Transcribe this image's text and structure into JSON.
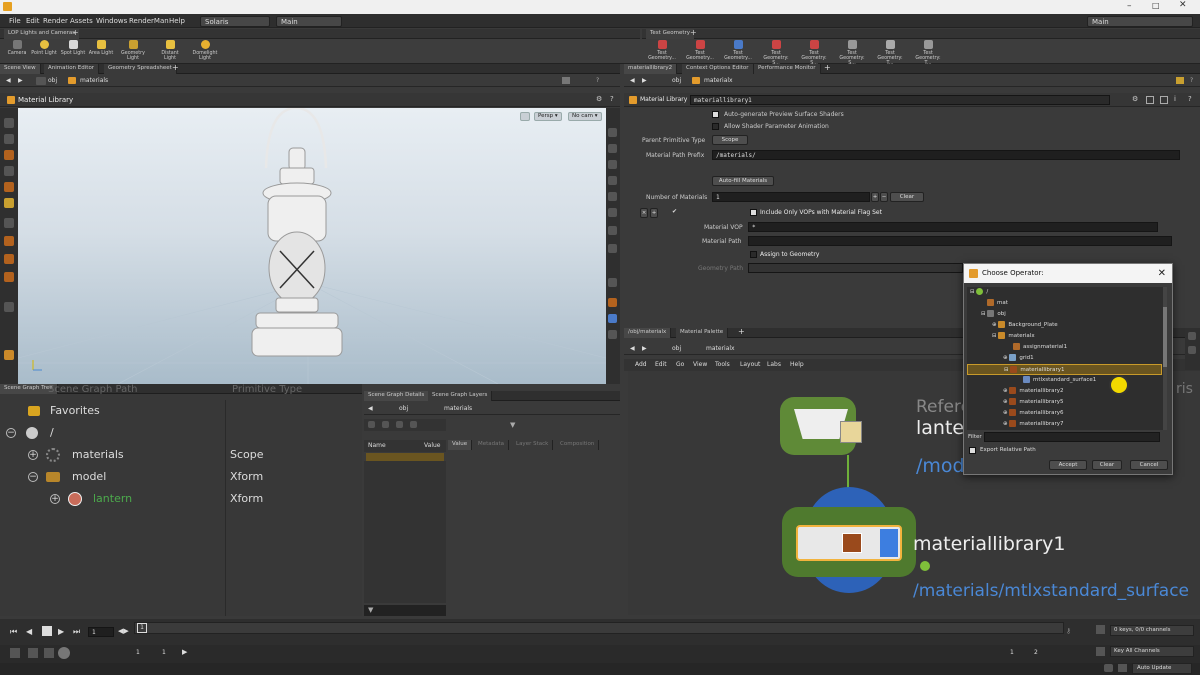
{
  "menubar": {
    "items": [
      "File",
      "Edit",
      "Render",
      "Assets",
      "Windows",
      "RenderMan",
      "Help"
    ],
    "desktop": "Solaris",
    "session": "Main",
    "right_session": "Main"
  },
  "shelf": {
    "left_tab": "LOP Lights and Cameras",
    "right_tab": "Test Geometry",
    "left_tools": [
      "Camera",
      "Point Light",
      "Spot Light",
      "Area Light",
      "Geometry Light",
      "Distant Light",
      "Domelight Light"
    ],
    "right_tools": [
      "Test Geometry...",
      "Test Geometry...",
      "Test Geometry...",
      "Test Geometry: S...",
      "Test Geometry: S...",
      "Test Geometry: S...",
      "Test Geometry: T...",
      "Test Geometry: T..."
    ]
  },
  "left_top": {
    "tabs": [
      "Scene View",
      "Animation Editor",
      "Geometry Spreadsheet"
    ],
    "path": "obj",
    "path2": "materials",
    "title": "Material Library",
    "cam_persp": "Persp",
    "cam_nocam": "No cam"
  },
  "scene_tree": {
    "tab": "Scene Graph Tree",
    "col_path": "Scene Graph Path",
    "col_type": "Primitive Type",
    "rows": [
      {
        "label": "Favorites",
        "type": ""
      },
      {
        "label": "/",
        "type": ""
      },
      {
        "label": "materials",
        "type": "Scope"
      },
      {
        "label": "model",
        "type": "Xform"
      },
      {
        "label": "lantern",
        "type": "Xform"
      }
    ]
  },
  "details": {
    "tabs": [
      "Scene Graph Details",
      "Scene Graph Layers"
    ],
    "path": "obj",
    "path2": "materials",
    "col_name": "Name",
    "col_value": "Value",
    "subtabs": [
      "Value",
      "Metadata",
      "Layer Stack",
      "Composition"
    ]
  },
  "params": {
    "tabs": [
      "materiallibrary2",
      "Context Options Editor",
      "Performance Monitor"
    ],
    "path": "obj",
    "path2": "materialx",
    "node_type": "Material Library",
    "node_name": "materiallibrary1",
    "auto_preview": "Auto-generate Preview Surface Shaders",
    "allow_anim": "Allow Shader Parameter Animation",
    "parent_prim_label": "Parent Primitive Type",
    "parent_prim_value": "Scope",
    "prefix_label": "Material Path Prefix",
    "prefix_value": "/materials/",
    "autofill": "Auto-fill Materials",
    "num_label": "Number of Materials",
    "num_value": "1",
    "clear": "Clear",
    "include_only": "Include Only VOPs with Material Flag Set",
    "vop_label": "Material VOP",
    "vop_value": "*",
    "matpath_label": "Material Path",
    "assign_label": "Assign to Geometry",
    "geopath_label": "Geometry Path"
  },
  "network": {
    "tabs": [
      "/obj/materialx",
      "Material Palette"
    ],
    "path": "obj",
    "path2": "materialx",
    "menu": [
      "Add",
      "Edit",
      "Go",
      "View",
      "Tools",
      "Layout",
      "Labs",
      "Help"
    ],
    "ref_label": "Refere",
    "ref_node": "lante",
    "ref_path": "/mod",
    "node_name": "materiallibrary1",
    "node_path": "/materials/mtlxstandard_surface",
    "edge_text": "ris"
  },
  "dialog": {
    "title": "Choose Operator:",
    "filter_label": "Filter",
    "export_label": "Export Relative Path",
    "accept": "Accept",
    "clear": "Clear",
    "cancel": "Cancel",
    "tree": [
      "/",
      "mat",
      "obj",
      "Background_Plate",
      "materialx",
      "assignmaterial1",
      "grid1",
      "materiallibrary1",
      "mtlxstandard_surface1",
      "materiallibrary2",
      "materiallibrary5",
      "materiallibrary6",
      "materiallibrary7"
    ]
  },
  "timeline": {
    "frame": "1",
    "start": "1",
    "start2": "1",
    "end": "1",
    "end2": "2",
    "keys": "0 keys, 0/0 channels",
    "key_all": "Key All Channels",
    "auto_update": "Auto Update"
  },
  "colors": {
    "accent": "#f2b33d",
    "select": "#c89a2a",
    "node_blue": "#3d7ee0",
    "green": "#7fbf3a"
  }
}
